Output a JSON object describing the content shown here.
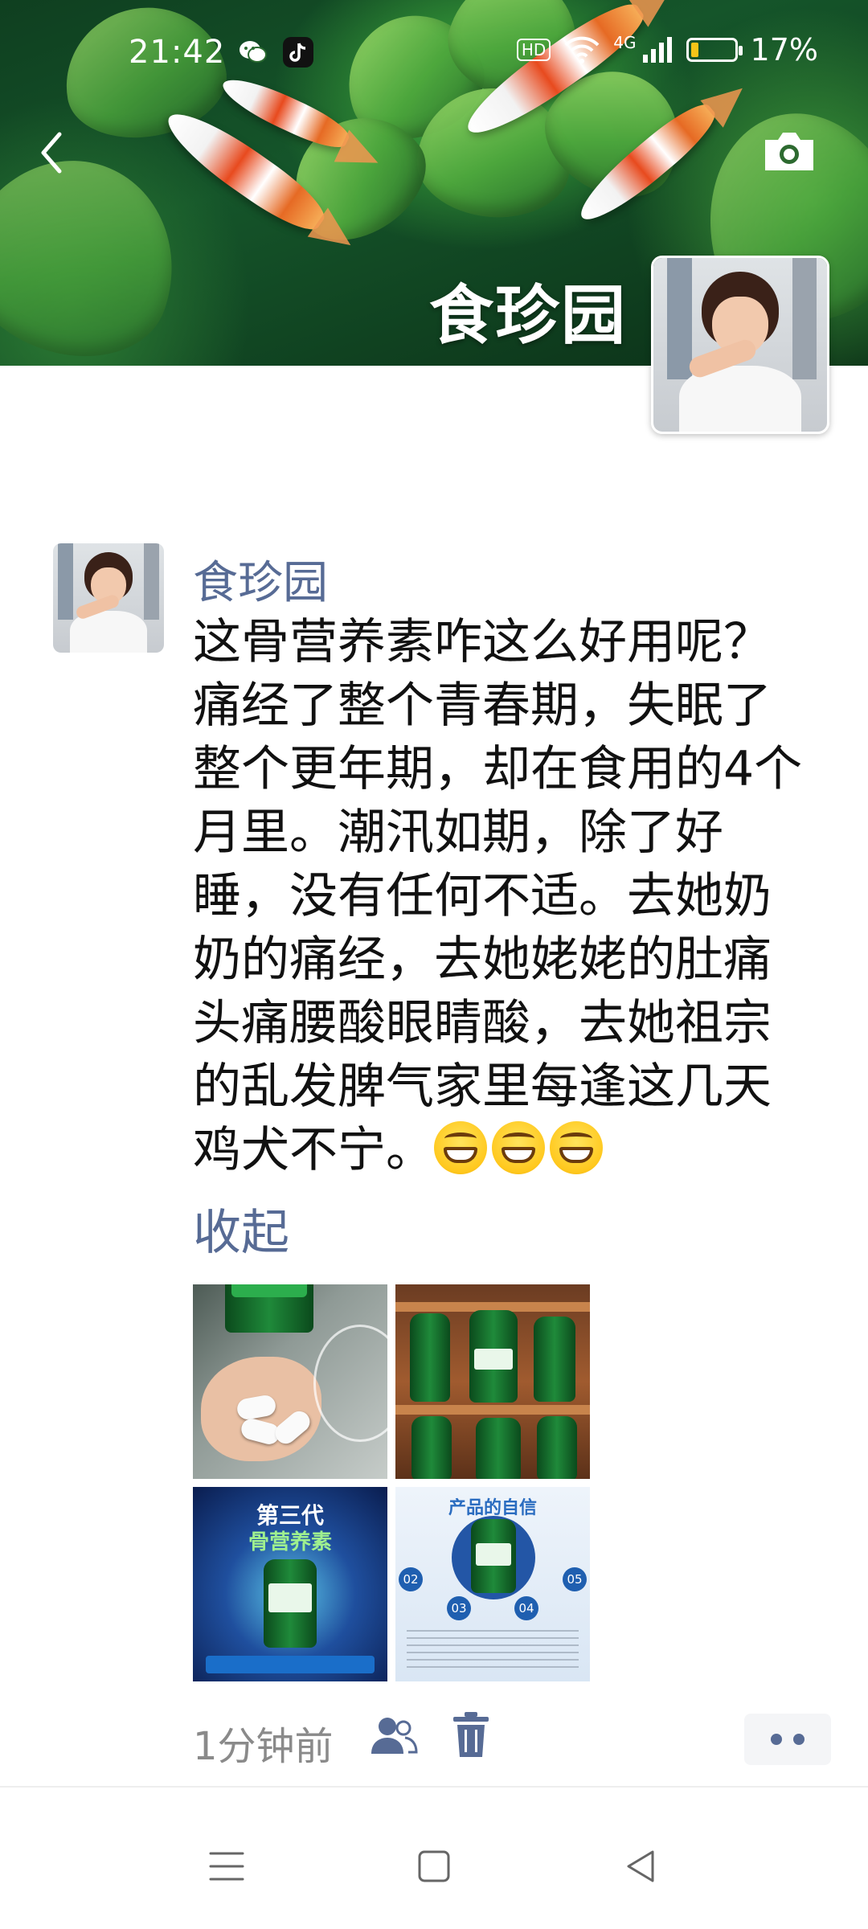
{
  "status_bar": {
    "time": "21:42",
    "hd_badge": "HD",
    "network": "4G",
    "battery_percent": "17%",
    "battery_level": 0.17,
    "icons": [
      "wechat-icon",
      "tiktok-icon",
      "wifi-icon",
      "signal-icon",
      "battery-icon"
    ]
  },
  "cover": {
    "name": "食珍园",
    "icons": [
      "back-icon",
      "camera-icon"
    ]
  },
  "post": {
    "author": "食珍园",
    "text": "这骨营养素咋这么好用呢？痛经了整个青春期，失眠了整个更年期，却在食用的4个月里。潮汛如期，除了好睡，没有任何不适。去她奶奶的痛经，去她姥姥的肚痛头痛腰酸眼睛酸，去她祖宗的乱发脾气家里每逢这几天鸡犬不宁。",
    "emoji_count": 3,
    "emoji_name": "grin-emoji",
    "collapse_label": "收起",
    "timestamp": "1分钟前",
    "photos": [
      {
        "name": "photo-capsules-in-hand"
      },
      {
        "name": "photo-bottles-on-shelf"
      },
      {
        "name": "photo-third-generation-poster",
        "title": "第三代",
        "subtitle": "骨营养素"
      },
      {
        "name": "photo-product-confidence",
        "title": "产品的自信",
        "numbers": [
          "02",
          "03",
          "04",
          "05"
        ]
      }
    ]
  },
  "colors": {
    "link": "#576b95",
    "timestamp": "#8a8a8a",
    "text": "#111111"
  },
  "nav_bar": {
    "icons": [
      "menu-icon",
      "home-icon",
      "back-triangle-icon"
    ]
  }
}
